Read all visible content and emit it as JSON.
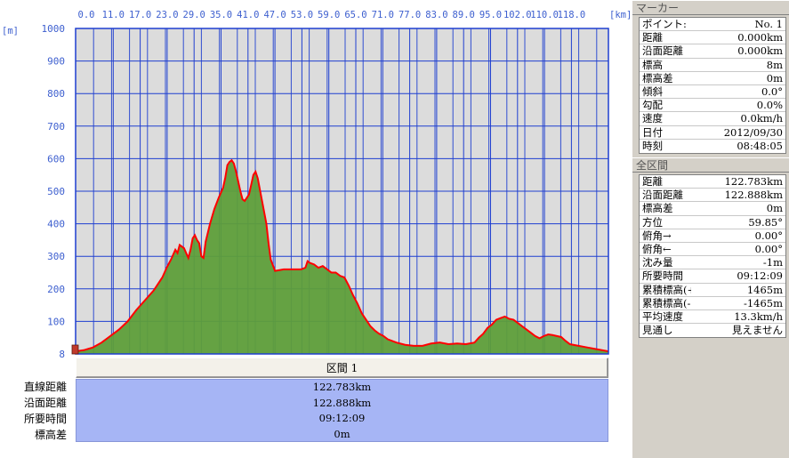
{
  "chart_data": {
    "type": "area",
    "xlabel": "[km]",
    "ylabel": "[m]",
    "x_tick_labels": [
      "0.0",
      "11.0",
      "17.0",
      "23.0",
      "29.0",
      "35.0",
      "41.0",
      "47.0",
      "53.0",
      "59.0",
      "65.0",
      "71.0",
      "77.0",
      "83.0",
      "89.0",
      "95.0",
      "102.0",
      "110.0",
      "118.0"
    ],
    "y_ticks": [
      1000,
      900,
      800,
      700,
      600,
      500,
      400,
      300,
      200,
      100,
      8
    ],
    "ylim": [
      0,
      1000
    ],
    "xlim": [
      0,
      122.888
    ],
    "grid": true,
    "fill_color": "#5e9e3a",
    "line_color": "#ff0000",
    "plot_background": "#dcdcdc",
    "grid_color": "#1f3fd0",
    "x": [
      0,
      2,
      4,
      6,
      8,
      10,
      12,
      14,
      16,
      18,
      20,
      21,
      22,
      22.5,
      23,
      23.5,
      24,
      25,
      26,
      26.5,
      27,
      27.5,
      28,
      28.5,
      29,
      29.5,
      30,
      31,
      32,
      33,
      34,
      34.5,
      35,
      35.5,
      36,
      36.5,
      37,
      38,
      38.5,
      39,
      39.5,
      40,
      40.5,
      41,
      41.5,
      42,
      43,
      44,
      44.5,
      45,
      46,
      48,
      50,
      52,
      53,
      53.5,
      54,
      55,
      56,
      57,
      58,
      59,
      60,
      61,
      62,
      63,
      64,
      65,
      66,
      67,
      68,
      69,
      70,
      71,
      72,
      74,
      76,
      78,
      80,
      82,
      84,
      86,
      88,
      90,
      92,
      93,
      94,
      95,
      96,
      97,
      98,
      99,
      100,
      101,
      102,
      103,
      104,
      105,
      106,
      107,
      108,
      109,
      110,
      111,
      112,
      113,
      114,
      116,
      118,
      120,
      122.888
    ],
    "y": [
      8,
      12,
      20,
      35,
      55,
      75,
      100,
      135,
      165,
      195,
      235,
      265,
      290,
      305,
      320,
      310,
      335,
      325,
      295,
      320,
      355,
      365,
      350,
      340,
      300,
      295,
      345,
      400,
      445,
      480,
      510,
      540,
      580,
      590,
      595,
      585,
      560,
      500,
      475,
      470,
      480,
      490,
      520,
      550,
      560,
      540,
      470,
      400,
      340,
      290,
      255,
      260,
      260,
      260,
      265,
      285,
      280,
      275,
      265,
      270,
      260,
      250,
      250,
      240,
      235,
      210,
      180,
      155,
      125,
      105,
      85,
      72,
      62,
      55,
      45,
      35,
      28,
      25,
      25,
      32,
      35,
      30,
      32,
      30,
      35,
      50,
      62,
      80,
      90,
      105,
      110,
      115,
      108,
      105,
      95,
      85,
      75,
      65,
      55,
      48,
      55,
      60,
      58,
      55,
      52,
      40,
      30,
      25,
      20,
      15,
      8
    ]
  },
  "section_header": "区間 1",
  "summary": {
    "labels": [
      "直線距離",
      "沿面距離",
      "所要時間",
      "標高差"
    ],
    "values": [
      "122.783km",
      "122.888km",
      "09:12:09",
      "0m"
    ]
  },
  "marker_panel": {
    "title": "マーカー",
    "rows": [
      {
        "label": "ポイント:",
        "value": "No. 1"
      },
      {
        "label": "距離",
        "value": "0.000km"
      },
      {
        "label": "沿面距離",
        "value": "0.000km"
      },
      {
        "label": "標高",
        "value": "8m"
      },
      {
        "label": "標高差",
        "value": "0m"
      },
      {
        "label": "傾斜",
        "value": "0.0°"
      },
      {
        "label": "勾配",
        "value": "0.0%"
      },
      {
        "label": "速度",
        "value": "0.0km/h"
      },
      {
        "label": "日付",
        "value": "2012/09/30"
      },
      {
        "label": "時刻",
        "value": "08:48:05"
      }
    ]
  },
  "total_panel": {
    "title": "全区間",
    "rows": [
      {
        "label": "距離",
        "value": "122.783km"
      },
      {
        "label": "沿面距離",
        "value": "122.888km"
      },
      {
        "label": "標高差",
        "value": "0m"
      },
      {
        "label": "方位",
        "value": "59.85°"
      },
      {
        "label": "俯角→",
        "value": "0.00°"
      },
      {
        "label": "俯角←",
        "value": "0.00°"
      },
      {
        "label": "沈み量",
        "value": "-1m"
      },
      {
        "label": "所要時間",
        "value": "09:12:09"
      },
      {
        "label": "累積標高(+)",
        "value": "1465m"
      },
      {
        "label": "累積標高(-)",
        "value": "-1465m"
      },
      {
        "label": "平均速度",
        "value": "13.3km/h"
      },
      {
        "label": "見通し",
        "value": "見えません"
      }
    ]
  }
}
